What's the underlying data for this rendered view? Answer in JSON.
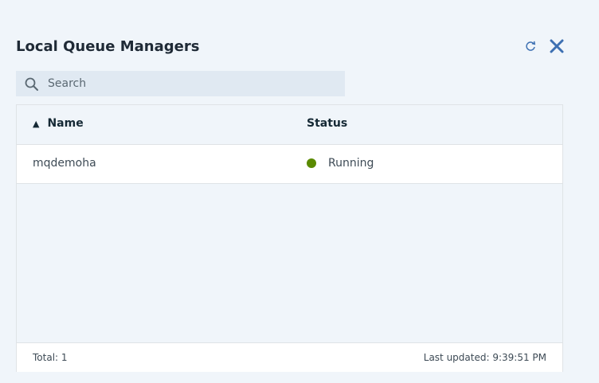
{
  "panel": {
    "title": "Local Queue Managers",
    "refresh_icon": "refresh-icon",
    "close_icon": "close-icon"
  },
  "search": {
    "placeholder": "Search",
    "value": "",
    "icon": "search-icon"
  },
  "table": {
    "columns": [
      {
        "label": "Name",
        "sort": "ascending"
      },
      {
        "label": "Status"
      }
    ],
    "rows": [
      {
        "name": "mqdemoha",
        "status": "Running",
        "status_color": "#5a8a00"
      }
    ],
    "footer": {
      "total": "Total: 1",
      "last_updated": "Last updated: 9:39:51 PM"
    }
  },
  "colors": {
    "accent": "#3d70b2",
    "running": "#5a8a00",
    "background": "#f0f5fa"
  }
}
